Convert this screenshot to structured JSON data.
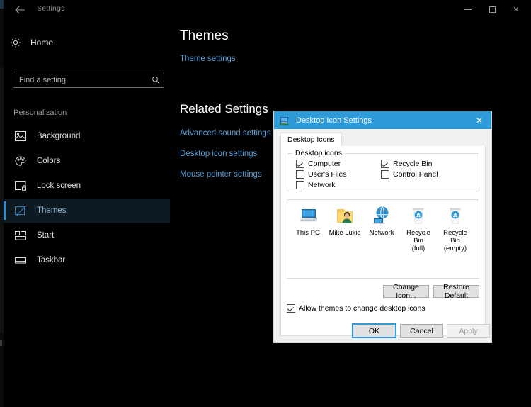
{
  "settings_window": {
    "title": "Settings",
    "back_icon": "back-arrow-icon",
    "window_controls": {
      "minimize": "minimize-icon",
      "maximize": "maximize-icon",
      "close": "close-icon"
    },
    "nav": {
      "home_label": "Home",
      "home_icon": "gear-icon",
      "search": {
        "placeholder": "Find a setting",
        "value": "",
        "icon": "search-icon"
      },
      "group_title": "Personalization",
      "items": [
        {
          "label": "Background",
          "icon": "image-icon",
          "selected": false
        },
        {
          "label": "Colors",
          "icon": "palette-icon",
          "selected": false
        },
        {
          "label": "Lock screen",
          "icon": "lockscreen-icon",
          "selected": false
        },
        {
          "label": "Themes",
          "icon": "brush-icon",
          "selected": true
        },
        {
          "label": "Start",
          "icon": "start-icon",
          "selected": false
        },
        {
          "label": "Taskbar",
          "icon": "taskbar-icon",
          "selected": false
        }
      ]
    },
    "main": {
      "page_title": "Themes",
      "theme_settings_link": "Theme settings",
      "related_title": "Related Settings",
      "related_links": [
        "Advanced sound settings",
        "Desktop icon settings",
        "Mouse pointer settings"
      ]
    },
    "accent_color": "#2a8fd4",
    "link_color": "#5aa0d8",
    "background_color": "#000000"
  },
  "dialog": {
    "title": "Desktop Icon Settings",
    "title_icon": "monitor-icon",
    "close_icon": "close-icon",
    "titlebar_color": "#2f9ad8",
    "tabs": [
      {
        "label": "Desktop Icons",
        "active": true
      }
    ],
    "group": {
      "legend": "Desktop icons",
      "checkboxes": [
        {
          "label": "Computer",
          "checked": true,
          "column": "left"
        },
        {
          "label": "User's Files",
          "checked": false,
          "column": "left"
        },
        {
          "label": "Network",
          "checked": false,
          "column": "left"
        },
        {
          "label": "Recycle Bin",
          "checked": true,
          "column": "right"
        },
        {
          "label": "Control Panel",
          "checked": false,
          "column": "right"
        }
      ]
    },
    "preview_icons": [
      {
        "caption": "This PC",
        "icon": "computer-icon"
      },
      {
        "caption": "Mike Lukic",
        "icon": "user-folder-icon"
      },
      {
        "caption": "Network",
        "icon": "network-icon"
      },
      {
        "caption": "Recycle Bin\n(full)",
        "icon": "recycle-bin-full-icon"
      },
      {
        "caption": "Recycle Bin\n(empty)",
        "icon": "recycle-bin-empty-icon"
      }
    ],
    "buttons": {
      "change_icon": "Change Icon...",
      "restore_default": "Restore Default"
    },
    "allow_themes": {
      "label": "Allow themes to change desktop icons",
      "checked": true
    },
    "footer": {
      "ok": "OK",
      "cancel": "Cancel",
      "apply": "Apply",
      "apply_disabled": true
    }
  }
}
